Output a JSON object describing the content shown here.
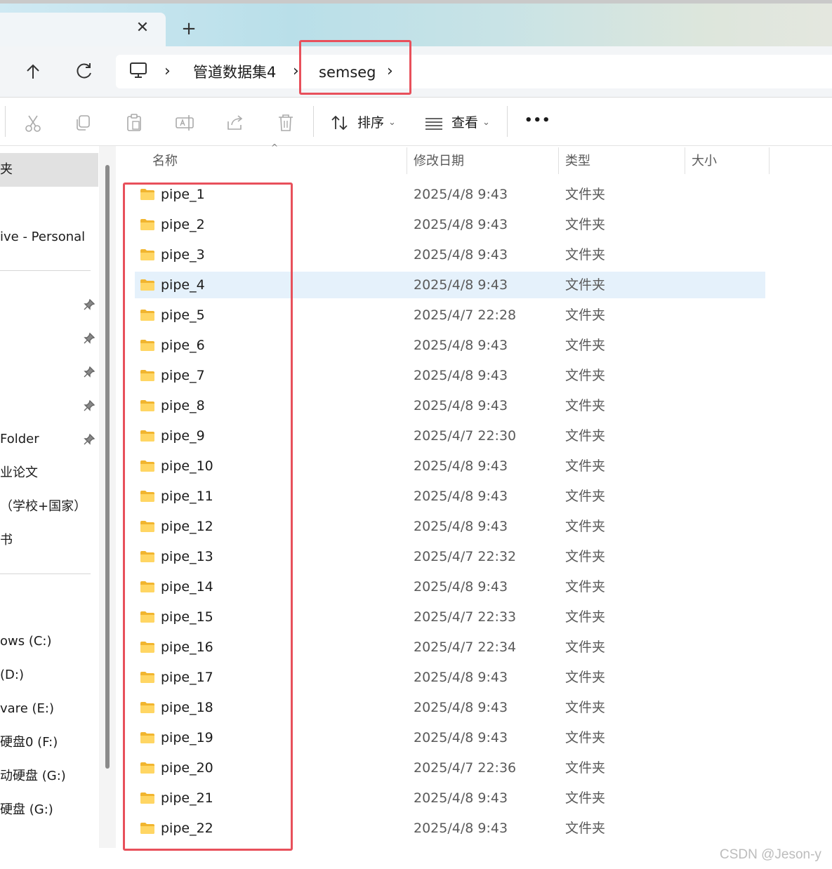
{
  "tab": {
    "close_glyph": "✕",
    "new_glyph": "+"
  },
  "nav": {
    "up_icon": "arrow-up-icon",
    "refresh_icon": "refresh-icon",
    "breadcrumb": [
      "管道数据集4",
      "semseg"
    ]
  },
  "toolbar": {
    "sort_label": "排序",
    "view_label": "查看",
    "more_label": "•••",
    "icons": [
      "cut-icon",
      "copy-icon",
      "paste-icon",
      "rename-icon",
      "share-icon",
      "delete-icon"
    ]
  },
  "sidebar": {
    "items": [
      {
        "label": "夹",
        "selected": true
      },
      {
        "label": "ive - Personal"
      },
      {
        "label": "Folder"
      },
      {
        "label": "业论文"
      },
      {
        "label": "（学校+国家）"
      },
      {
        "label": "书"
      },
      {
        "label": "ows (C:)"
      },
      {
        "label": "(D:)"
      },
      {
        "label": "vare (E:)"
      },
      {
        "label": "硬盘0 (F:)"
      },
      {
        "label": "动硬盘 (G:)"
      },
      {
        "label": "硬盘 (G:)"
      }
    ]
  },
  "columns": {
    "name": "名称",
    "modified": "修改日期",
    "type": "类型",
    "size": "大小"
  },
  "files": [
    {
      "name": "pipe_1",
      "date": "2025/4/8 9:43",
      "type": "文件夹"
    },
    {
      "name": "pipe_2",
      "date": "2025/4/8 9:43",
      "type": "文件夹"
    },
    {
      "name": "pipe_3",
      "date": "2025/4/8 9:43",
      "type": "文件夹"
    },
    {
      "name": "pipe_4",
      "date": "2025/4/8 9:43",
      "type": "文件夹",
      "hover": true
    },
    {
      "name": "pipe_5",
      "date": "2025/4/7 22:28",
      "type": "文件夹"
    },
    {
      "name": "pipe_6",
      "date": "2025/4/8 9:43",
      "type": "文件夹"
    },
    {
      "name": "pipe_7",
      "date": "2025/4/8 9:43",
      "type": "文件夹"
    },
    {
      "name": "pipe_8",
      "date": "2025/4/8 9:43",
      "type": "文件夹"
    },
    {
      "name": "pipe_9",
      "date": "2025/4/7 22:30",
      "type": "文件夹"
    },
    {
      "name": "pipe_10",
      "date": "2025/4/8 9:43",
      "type": "文件夹"
    },
    {
      "name": "pipe_11",
      "date": "2025/4/8 9:43",
      "type": "文件夹"
    },
    {
      "name": "pipe_12",
      "date": "2025/4/8 9:43",
      "type": "文件夹"
    },
    {
      "name": "pipe_13",
      "date": "2025/4/7 22:32",
      "type": "文件夹"
    },
    {
      "name": "pipe_14",
      "date": "2025/4/8 9:43",
      "type": "文件夹"
    },
    {
      "name": "pipe_15",
      "date": "2025/4/7 22:33",
      "type": "文件夹"
    },
    {
      "name": "pipe_16",
      "date": "2025/4/7 22:34",
      "type": "文件夹"
    },
    {
      "name": "pipe_17",
      "date": "2025/4/8 9:43",
      "type": "文件夹"
    },
    {
      "name": "pipe_18",
      "date": "2025/4/8 9:43",
      "type": "文件夹"
    },
    {
      "name": "pipe_19",
      "date": "2025/4/8 9:43",
      "type": "文件夹"
    },
    {
      "name": "pipe_20",
      "date": "2025/4/7 22:36",
      "type": "文件夹"
    },
    {
      "name": "pipe_21",
      "date": "2025/4/8 9:43",
      "type": "文件夹"
    },
    {
      "name": "pipe_22",
      "date": "2025/4/8 9:43",
      "type": "文件夹"
    }
  ],
  "watermark": "CSDN @Jeson-y",
  "colors": {
    "highlight": "#e8505b",
    "hover_row": "#e5f1fb",
    "folder": "#f8c443"
  }
}
